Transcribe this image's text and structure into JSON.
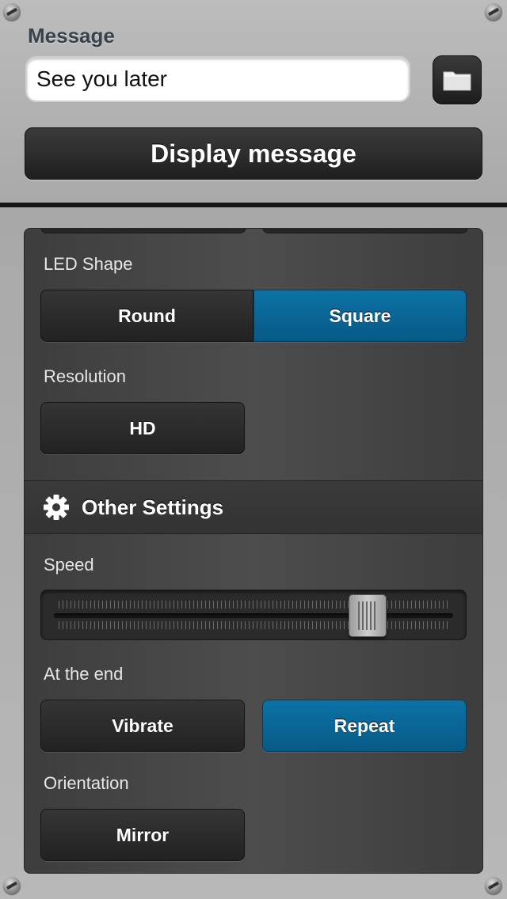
{
  "message": {
    "label": "Message",
    "input_value": "See you later",
    "display_button": "Display message"
  },
  "led_shape": {
    "label": "LED Shape",
    "options": [
      "Round",
      "Square"
    ],
    "selected": "Square"
  },
  "resolution": {
    "label": "Resolution",
    "button": "HD"
  },
  "other_settings": {
    "title": "Other Settings"
  },
  "speed": {
    "label": "Speed",
    "value": 0.81
  },
  "at_the_end": {
    "label": "At the end",
    "options": [
      "Vibrate",
      "Repeat"
    ],
    "selected": "Repeat"
  },
  "orientation": {
    "label": "Orientation",
    "button": "Mirror"
  },
  "icons": {
    "folder": "folder-icon",
    "gear": "gear-icon",
    "screw": "screw-icon"
  },
  "colors": {
    "accent": "#0a6a9c",
    "button_dark": "#262626",
    "panel": "#444444"
  }
}
